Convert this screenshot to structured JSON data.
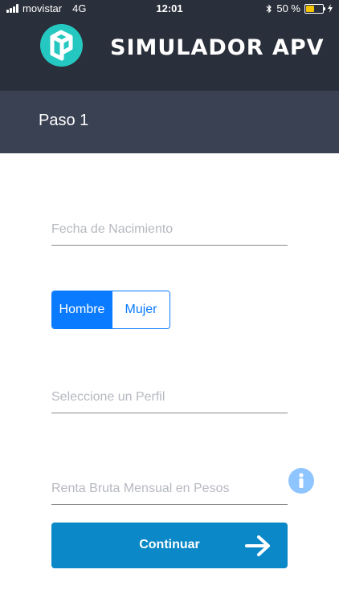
{
  "status_bar": {
    "carrier": "movistar",
    "network": "4G",
    "time": "12:01",
    "battery": "50 %",
    "battery_level_percent": 50
  },
  "header": {
    "app_title": "SIMULADOR APV",
    "logo_icon": "cube-logo-icon"
  },
  "step": {
    "title": "Paso 1"
  },
  "form": {
    "birth_date": {
      "placeholder": "Fecha de Nacimiento",
      "value": ""
    },
    "gender": {
      "options": [
        "Hombre",
        "Mujer"
      ],
      "selected": "Hombre"
    },
    "profile": {
      "placeholder": "Seleccione un Perfil",
      "value": ""
    },
    "income": {
      "placeholder": "Renta Bruta Mensual en Pesos",
      "value": ""
    },
    "info_icon": "info-icon",
    "continue_label": "Continuar",
    "continue_icon": "arrow-right-icon"
  },
  "colors": {
    "header_bg": "#2a303b",
    "step_bg": "#3a4152",
    "accent_blue": "#0a7aff",
    "button_bg": "#0a88c7",
    "logo_teal": "#25c8c0",
    "info_light_blue": "#8fc5ff"
  }
}
